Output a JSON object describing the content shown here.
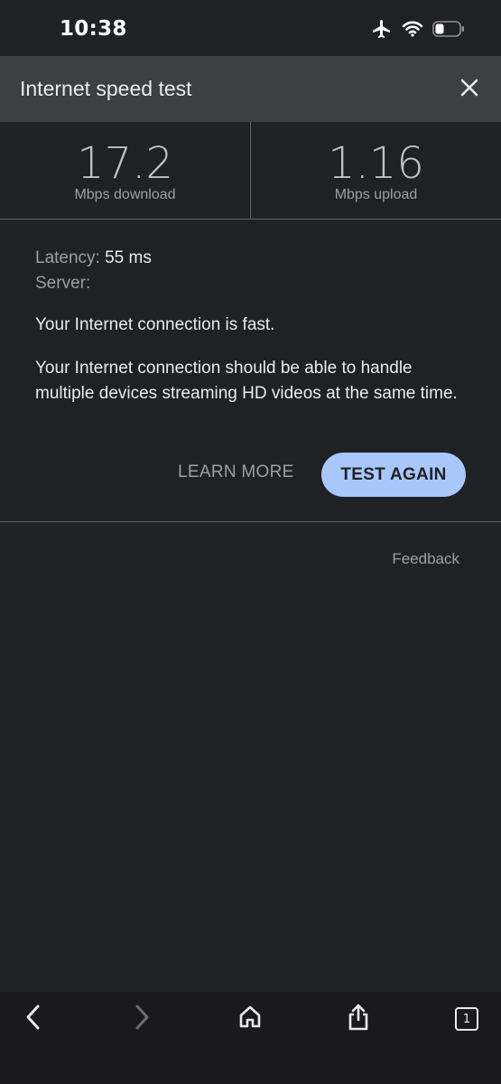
{
  "status_bar": {
    "time": "10:38",
    "icons": [
      "airplane-icon",
      "wifi-icon",
      "battery-icon"
    ]
  },
  "header": {
    "title": "Internet speed test",
    "close_icon": "close-icon"
  },
  "results": {
    "download": {
      "value": "17.2",
      "unit": "Mbps download"
    },
    "upload": {
      "value": "1.16",
      "unit": "Mbps upload"
    }
  },
  "details": {
    "latency_label": "Latency:",
    "latency_value": "55 ms",
    "server_label": "Server:",
    "summary": "Your Internet connection is fast.",
    "description": "Your Internet connection should be able to handle multiple devices streaming HD videos at the same time."
  },
  "actions": {
    "learn_more": "LEARN MORE",
    "test_again": "TEST AGAIN"
  },
  "feedback": "Feedback",
  "toolbar": {
    "tab_count": "1",
    "items": [
      "back-icon",
      "forward-icon",
      "home-icon",
      "share-icon",
      "tabs-icon"
    ]
  },
  "colors": {
    "background": "#202124",
    "header": "#3c4043",
    "accent_button": "#a8c7fa"
  }
}
